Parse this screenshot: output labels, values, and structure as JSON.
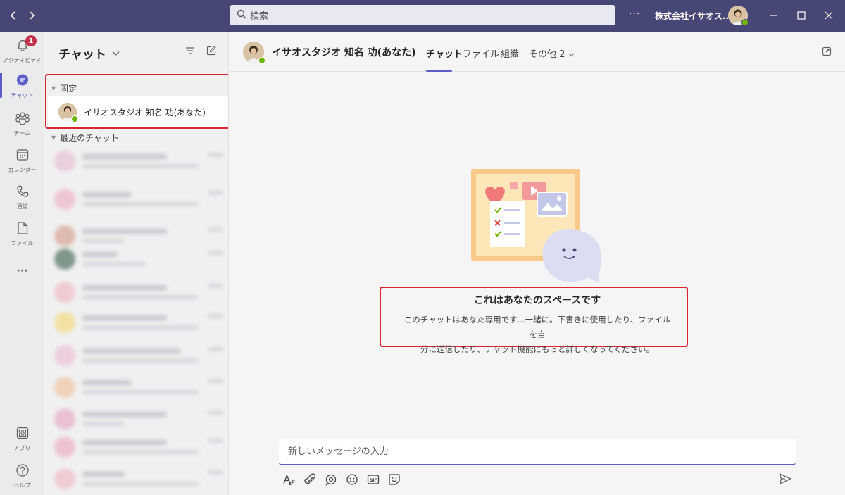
{
  "titlebar": {
    "search_placeholder": "検索",
    "more": "···",
    "org": "株式会社イサオス..."
  },
  "rail": {
    "activity": {
      "label": "アクティビティ",
      "badge": "1"
    },
    "chat": {
      "label": "チャット"
    },
    "teams": {
      "label": "チーム"
    },
    "calendar": {
      "label": "カレンダー"
    },
    "calls": {
      "label": "通話"
    },
    "files": {
      "label": "ファイル"
    },
    "more": "···",
    "apps": {
      "label": "アプリ"
    },
    "help": {
      "label": "ヘルプ"
    }
  },
  "list": {
    "title": "チャット",
    "pinned_label": "固定",
    "pinned_name": "イサオスタジオ 知名 功(あなた)",
    "recent_label": "最近のチャット"
  },
  "main": {
    "title": "イサオスタジオ 知名 功(あなた)",
    "tabs": [
      "チャット",
      "ファイル",
      "組織",
      "その他 2"
    ],
    "space_title": "これはあなたのスペースです",
    "space_desc_line1": "このチャットはあなた専用です...一緒に。下書きに使用したり、ファイルを自",
    "space_desc_line2": "分に送信したり、チャット機能にもっと詳しくなってください。",
    "composer_placeholder": "新しいメッセージの入力"
  },
  "colors": {
    "titlebar": "#464775",
    "accent": "#5b5fc7",
    "highlight": "#e0242f",
    "badge": "#c4314b",
    "presence": "#6bb700"
  }
}
